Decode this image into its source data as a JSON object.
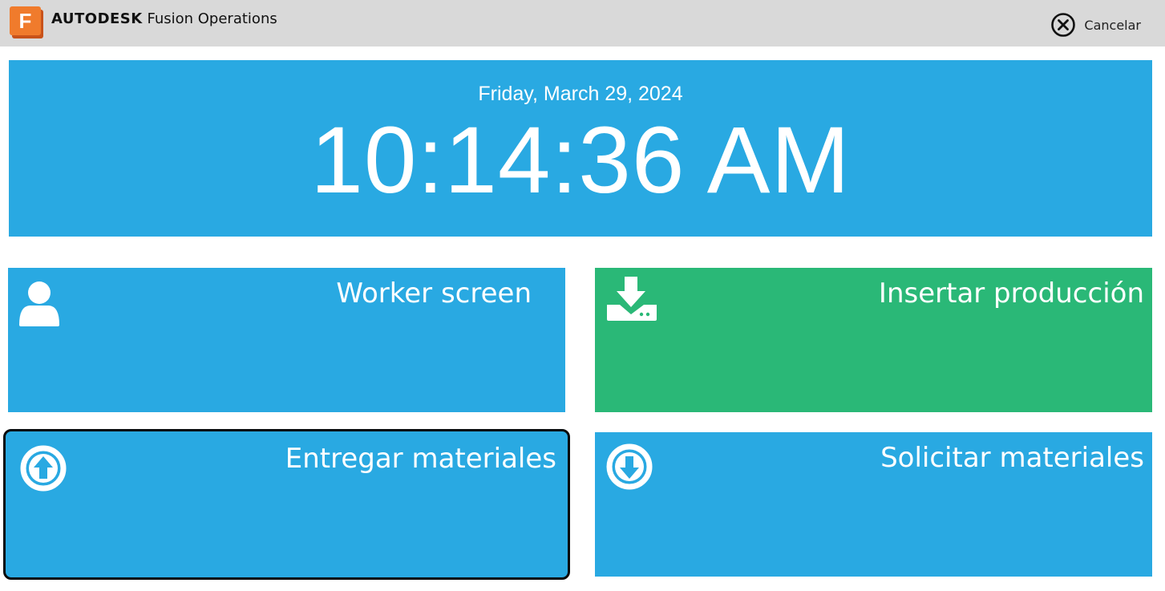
{
  "header": {
    "brand_bold": "AUTODESK",
    "brand_product": "Fusion Operations",
    "logo_letter": "F",
    "cancel_label": "Cancelar"
  },
  "clock": {
    "date": "Friday, March 29, 2024",
    "time": "10:14:36 AM"
  },
  "tiles": [
    {
      "label": "Worker screen",
      "icon": "user-icon",
      "color": "#29a9e2"
    },
    {
      "label": "Insertar producción",
      "icon": "download-tray-icon",
      "color": "#2ab877"
    },
    {
      "label": "Entregar materiales",
      "icon": "arrow-up-circle-icon",
      "color": "#29a9e2",
      "focused": true
    },
    {
      "label": "Solicitar materiales",
      "icon": "arrow-down-circle-icon",
      "color": "#29a9e2"
    }
  ],
  "colors": {
    "topbar": "#d9d9d9",
    "accent_blue": "#29a9e2",
    "accent_green": "#2ab877",
    "logo_orange": "#f07b2c"
  }
}
